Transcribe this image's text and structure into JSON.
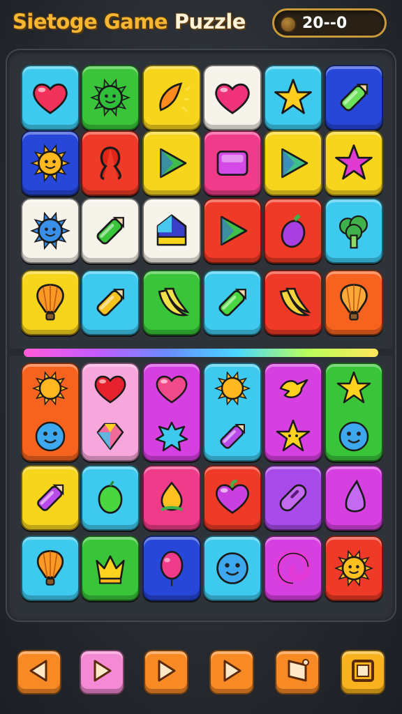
{
  "header": {
    "title_word1": "Sietoge",
    "title_word2": "Game",
    "title_word3": "Puzzle",
    "score": "20--0"
  },
  "colors": {
    "cyan": "#3ec9ef",
    "green": "#39c43a",
    "yellow": "#f7d51d",
    "white": "#f6f3ea",
    "blue": "#2747d8",
    "red": "#ee3a26",
    "pink": "#f03b8b",
    "magenta": "#d63fe0",
    "orange": "#f6631f",
    "lightpink": "#f7a7dc",
    "purple": "#a94aea"
  },
  "board_top": [
    [
      {
        "bg": "cyan",
        "icon": "heart-icon",
        "fill": "#f0325a"
      },
      {
        "bg": "green",
        "icon": "sun-face-icon",
        "fill": "#2fbf3a"
      },
      {
        "bg": "yellow",
        "icon": "sparkle-flame-icon",
        "fill": "#ff8a1e"
      },
      {
        "bg": "white",
        "icon": "heart-icon",
        "fill": "#f0327a"
      },
      {
        "bg": "cyan",
        "icon": "star-icon",
        "fill": "#ffce1f"
      },
      {
        "bg": "blue",
        "icon": "rainbow-crayon-icon",
        "fill": "#6de05a"
      }
    ],
    [
      {
        "bg": "blue",
        "icon": "sun-face-icon",
        "fill": "#ffb820"
      },
      {
        "bg": "red",
        "icon": "knot-icon",
        "fill": "#e02418"
      },
      {
        "bg": "yellow",
        "icon": "play-triangle-icon",
        "fill": "#3fbf4a"
      },
      {
        "bg": "pink",
        "icon": "gem-square-icon",
        "fill": "#d44ae6"
      },
      {
        "bg": "yellow",
        "icon": "play-triangle-icon",
        "fill": "#3fbf8a"
      },
      {
        "bg": "yellow",
        "icon": "star-icon",
        "fill": "#e13ad0"
      }
    ],
    [
      {
        "bg": "white",
        "icon": "sun-face-icon",
        "fill": "#3a8fe8"
      },
      {
        "bg": "white",
        "icon": "crayon-icon",
        "fill": "#39c43a"
      },
      {
        "bg": "white",
        "icon": "house-icon",
        "fill": "#3a3fc9"
      },
      {
        "bg": "red",
        "icon": "play-triangle-icon",
        "fill": "#3fbf4a"
      },
      {
        "bg": "red",
        "icon": "eggplant-icon",
        "fill": "#a93fe0"
      },
      {
        "bg": "cyan",
        "icon": "broccoli-icon",
        "fill": "#3fb04a"
      }
    ],
    [
      {
        "bg": "yellow",
        "icon": "hot-air-balloon-icon",
        "fill": "#f89a24"
      },
      {
        "bg": "cyan",
        "icon": "crayon-icon",
        "fill": "#f6c21d"
      },
      {
        "bg": "green",
        "icon": "banana-icon",
        "fill": "#f0e04a"
      },
      {
        "bg": "cyan",
        "icon": "crayon-icon",
        "fill": "#4ad640"
      },
      {
        "bg": "red",
        "icon": "banana-icon",
        "fill": "#f5d33a"
      },
      {
        "bg": "orange",
        "icon": "hot-air-balloon-icon",
        "fill": "#f9a83a"
      }
    ]
  ],
  "board_bottom_tall": [
    {
      "bg": "orange",
      "icons": [
        {
          "icon": "sun-icon",
          "fill": "#ffb820"
        },
        {
          "icon": "smiley-face-icon",
          "fill": "#3ea8ef"
        }
      ]
    },
    {
      "bg": "lightpink",
      "icons": [
        {
          "icon": "heart-icon",
          "fill": "#e6222e"
        },
        {
          "icon": "gem-icon",
          "fill": "#f06a9a"
        }
      ]
    },
    {
      "bg": "magenta",
      "icons": [
        {
          "icon": "heart-icon",
          "fill": "#f04a8a"
        },
        {
          "icon": "splat-icon",
          "fill": "#3ec9ef"
        }
      ]
    },
    {
      "bg": "cyan",
      "icons": [
        {
          "icon": "sun-icon",
          "fill": "#ffb820"
        },
        {
          "icon": "crayon-icon",
          "fill": "#b84aea"
        }
      ]
    },
    {
      "bg": "magenta",
      "icons": [
        {
          "icon": "bird-icon",
          "fill": "#ffd21f"
        },
        {
          "icon": "star-face-icon",
          "fill": "#ffd21f"
        }
      ]
    },
    {
      "bg": "green",
      "icons": [
        {
          "icon": "star-icon",
          "fill": "#ffd21f"
        },
        {
          "icon": "smiley-face-icon",
          "fill": "#3ea8ef"
        }
      ]
    }
  ],
  "board_bottom": [
    [
      {
        "bg": "yellow",
        "icon": "crayon-icon",
        "fill": "#b84aea"
      },
      {
        "bg": "cyan",
        "icon": "lime-icon",
        "fill": "#4ad640"
      },
      {
        "bg": "pink",
        "icon": "onion-icon",
        "fill": "#ffc020"
      },
      {
        "bg": "red",
        "icon": "heart-fruit-icon",
        "fill": "#c93fe0"
      },
      {
        "bg": "purple",
        "icon": "capsule-icon",
        "fill": "#c46af0"
      },
      {
        "bg": "magenta",
        "icon": "drop-icon",
        "fill": "#c46af0"
      }
    ],
    [
      {
        "bg": "cyan",
        "icon": "hot-air-balloon-icon",
        "fill": "#f89a24"
      },
      {
        "bg": "green",
        "icon": "crown-icon",
        "fill": "#ffd21f"
      },
      {
        "bg": "blue",
        "icon": "balloon-icon",
        "fill": "#f03b8b"
      },
      {
        "bg": "cyan",
        "icon": "smiley-face-icon",
        "fill": "#3ea8ef"
      },
      {
        "bg": "magenta",
        "icon": "swirl-icon",
        "fill": "#e23ad6"
      },
      {
        "bg": "red",
        "icon": "sun-face-icon",
        "fill": "#ffc020"
      }
    ]
  ],
  "controls": [
    {
      "name": "left-arrow-button",
      "bg": "#f78a25",
      "icon": "left-arrow-icon"
    },
    {
      "name": "play-button-pink",
      "bg": "#f58ad4",
      "icon": "play-icon"
    },
    {
      "name": "play-button-orange",
      "bg": "#f78a25",
      "icon": "play-icon"
    },
    {
      "name": "forward-button",
      "bg": "#f78a25",
      "icon": "play-icon"
    },
    {
      "name": "flag-button",
      "bg": "#f78a25",
      "icon": "flag-icon"
    },
    {
      "name": "stop-button",
      "bg": "#f7b21d",
      "icon": "square-icon"
    }
  ]
}
